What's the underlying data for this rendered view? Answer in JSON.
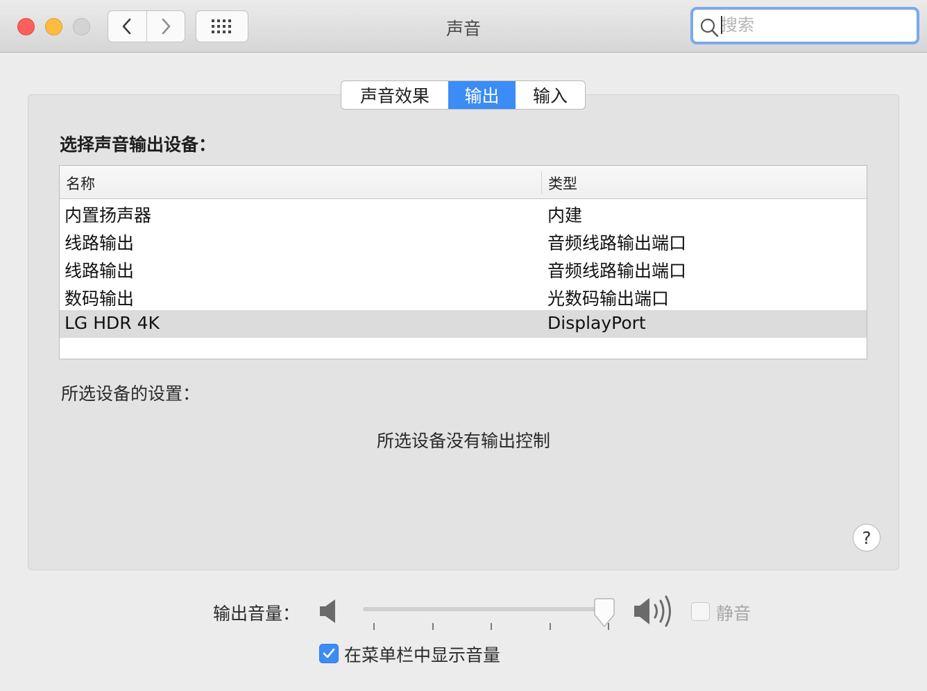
{
  "window": {
    "title": "声音",
    "search_placeholder": "搜索"
  },
  "tabs": [
    {
      "label": "声音效果",
      "active": false
    },
    {
      "label": "输出",
      "active": true
    },
    {
      "label": "输入",
      "active": false
    }
  ],
  "output": {
    "section_title": "选择声音输出设备：",
    "columns": [
      "名称",
      "类型"
    ],
    "devices": [
      {
        "name": "内置扬声器",
        "type": "内建",
        "selected": false
      },
      {
        "name": "线路输出",
        "type": "音频线路输出端口",
        "selected": false
      },
      {
        "name": "线路输出",
        "type": "音频线路输出端口",
        "selected": false
      },
      {
        "name": "数码输出",
        "type": "光数码输出端口",
        "selected": false
      },
      {
        "name": "LG HDR 4K",
        "type": "DisplayPort",
        "selected": true
      }
    ],
    "settings_label": "所选设备的设置：",
    "no_controls_message": "所选设备没有输出控制"
  },
  "help_label": "?",
  "volume": {
    "label": "输出音量：",
    "level_fraction": 0.98,
    "mute_label": "静音",
    "mute_checked": false
  },
  "menubar_option": {
    "label": "在菜单栏中显示音量",
    "checked": true
  },
  "colors": {
    "accent": "#3b8cf5",
    "close": "#fc605c",
    "minimize": "#fdbc40",
    "selected_row": "#dcdcdc"
  },
  "icons": [
    "back-chevron-icon",
    "forward-chevron-icon",
    "grid-icon",
    "search-icon",
    "speaker-low-icon",
    "speaker-high-icon",
    "checkmark-icon"
  ]
}
